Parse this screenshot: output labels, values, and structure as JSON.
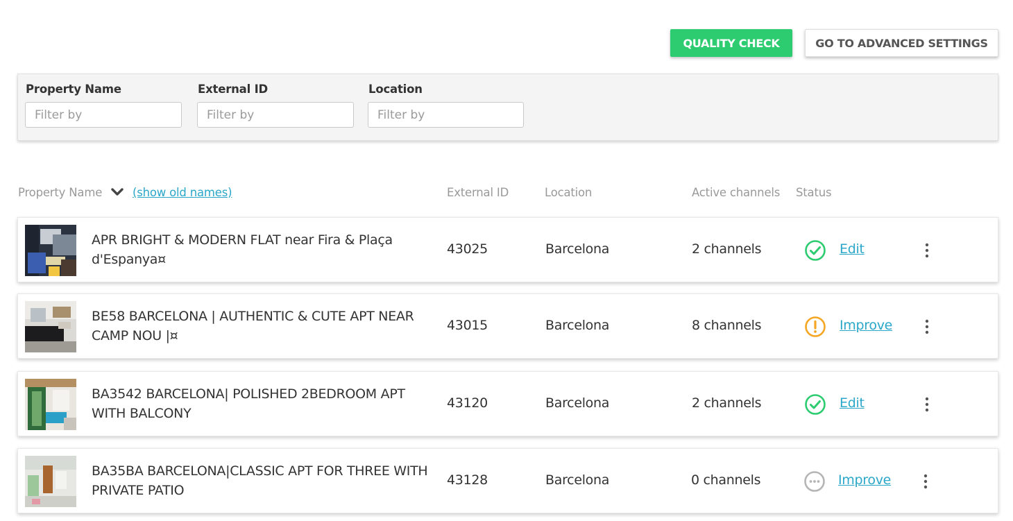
{
  "toolbar": {
    "quality_check_label": "QUALITY CHECK",
    "advanced_settings_label": "GO TO ADVANCED SETTINGS"
  },
  "filters": [
    {
      "label": "Property Name",
      "placeholder": "Filter by"
    },
    {
      "label": "External ID",
      "placeholder": "Filter by"
    },
    {
      "label": "Location",
      "placeholder": "Filter by"
    }
  ],
  "table": {
    "headers": {
      "property_name": "Property Name",
      "show_old_names": "(show old names)",
      "external_id": "External ID",
      "location": "Location",
      "active_channels": "Active channels",
      "status": "Status"
    },
    "sort_icon": "chevron-down-icon",
    "rows": [
      {
        "name": "APR BRIGHT & MODERN FLAT near Fira & Plaça d'Espanya¤",
        "external_id": "43025",
        "location": "Barcelona",
        "channels": "2 channels",
        "status": "ok",
        "status_icon": "check-circle-icon",
        "action": "Edit"
      },
      {
        "name": "BE58 BARCELONA | AUTHENTIC & CUTE APT NEAR CAMP NOU |¤",
        "external_id": "43015",
        "location": "Barcelona",
        "channels": "8 channels",
        "status": "warning",
        "status_icon": "exclamation-circle-icon",
        "action": "Improve"
      },
      {
        "name": "BA3542 BARCELONA| POLISHED 2BEDROOM APT WITH BALCONY",
        "external_id": "43120",
        "location": "Barcelona",
        "channels": "2 channels",
        "status": "ok",
        "status_icon": "check-circle-icon",
        "action": "Edit"
      },
      {
        "name": "BA35BA BARCELONA|CLASSIC APT FOR THREE WITH PRIVATE PATIO",
        "external_id": "43128",
        "location": "Barcelona",
        "channels": "0 channels",
        "status": "pending",
        "status_icon": "ellipsis-circle-icon",
        "action": "Improve"
      }
    ]
  },
  "colors": {
    "primary_green": "#2ecc71",
    "link_blue": "#2aa7c9",
    "warning_orange": "#f5a623",
    "pending_gray": "#b5b5b5"
  }
}
